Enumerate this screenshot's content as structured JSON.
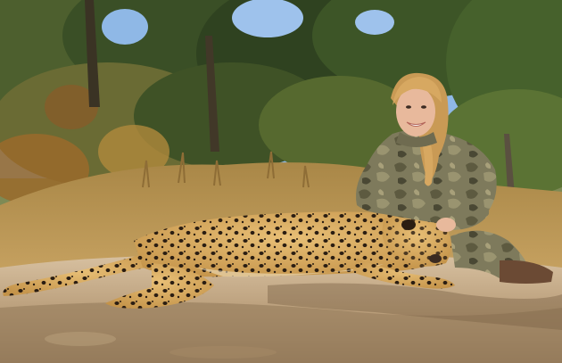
{
  "photo": {
    "subjects": [
      "hunter",
      "leopard",
      "rock",
      "bushveld",
      "sky"
    ],
    "colors": {
      "sky": "#8fb8e6",
      "tree_dark": "#2f4220",
      "tree_mid": "#4f6a2c",
      "dry_grass": "#c09a57",
      "rock": "#c6ad8b",
      "rock_shadow": "#8f7655",
      "leopard_coat": "#d6a85c",
      "leopard_spot": "#2a1d12",
      "camo": "#7d7a5c",
      "hair": "#d7a861",
      "skin": "#e8b99c"
    }
  }
}
